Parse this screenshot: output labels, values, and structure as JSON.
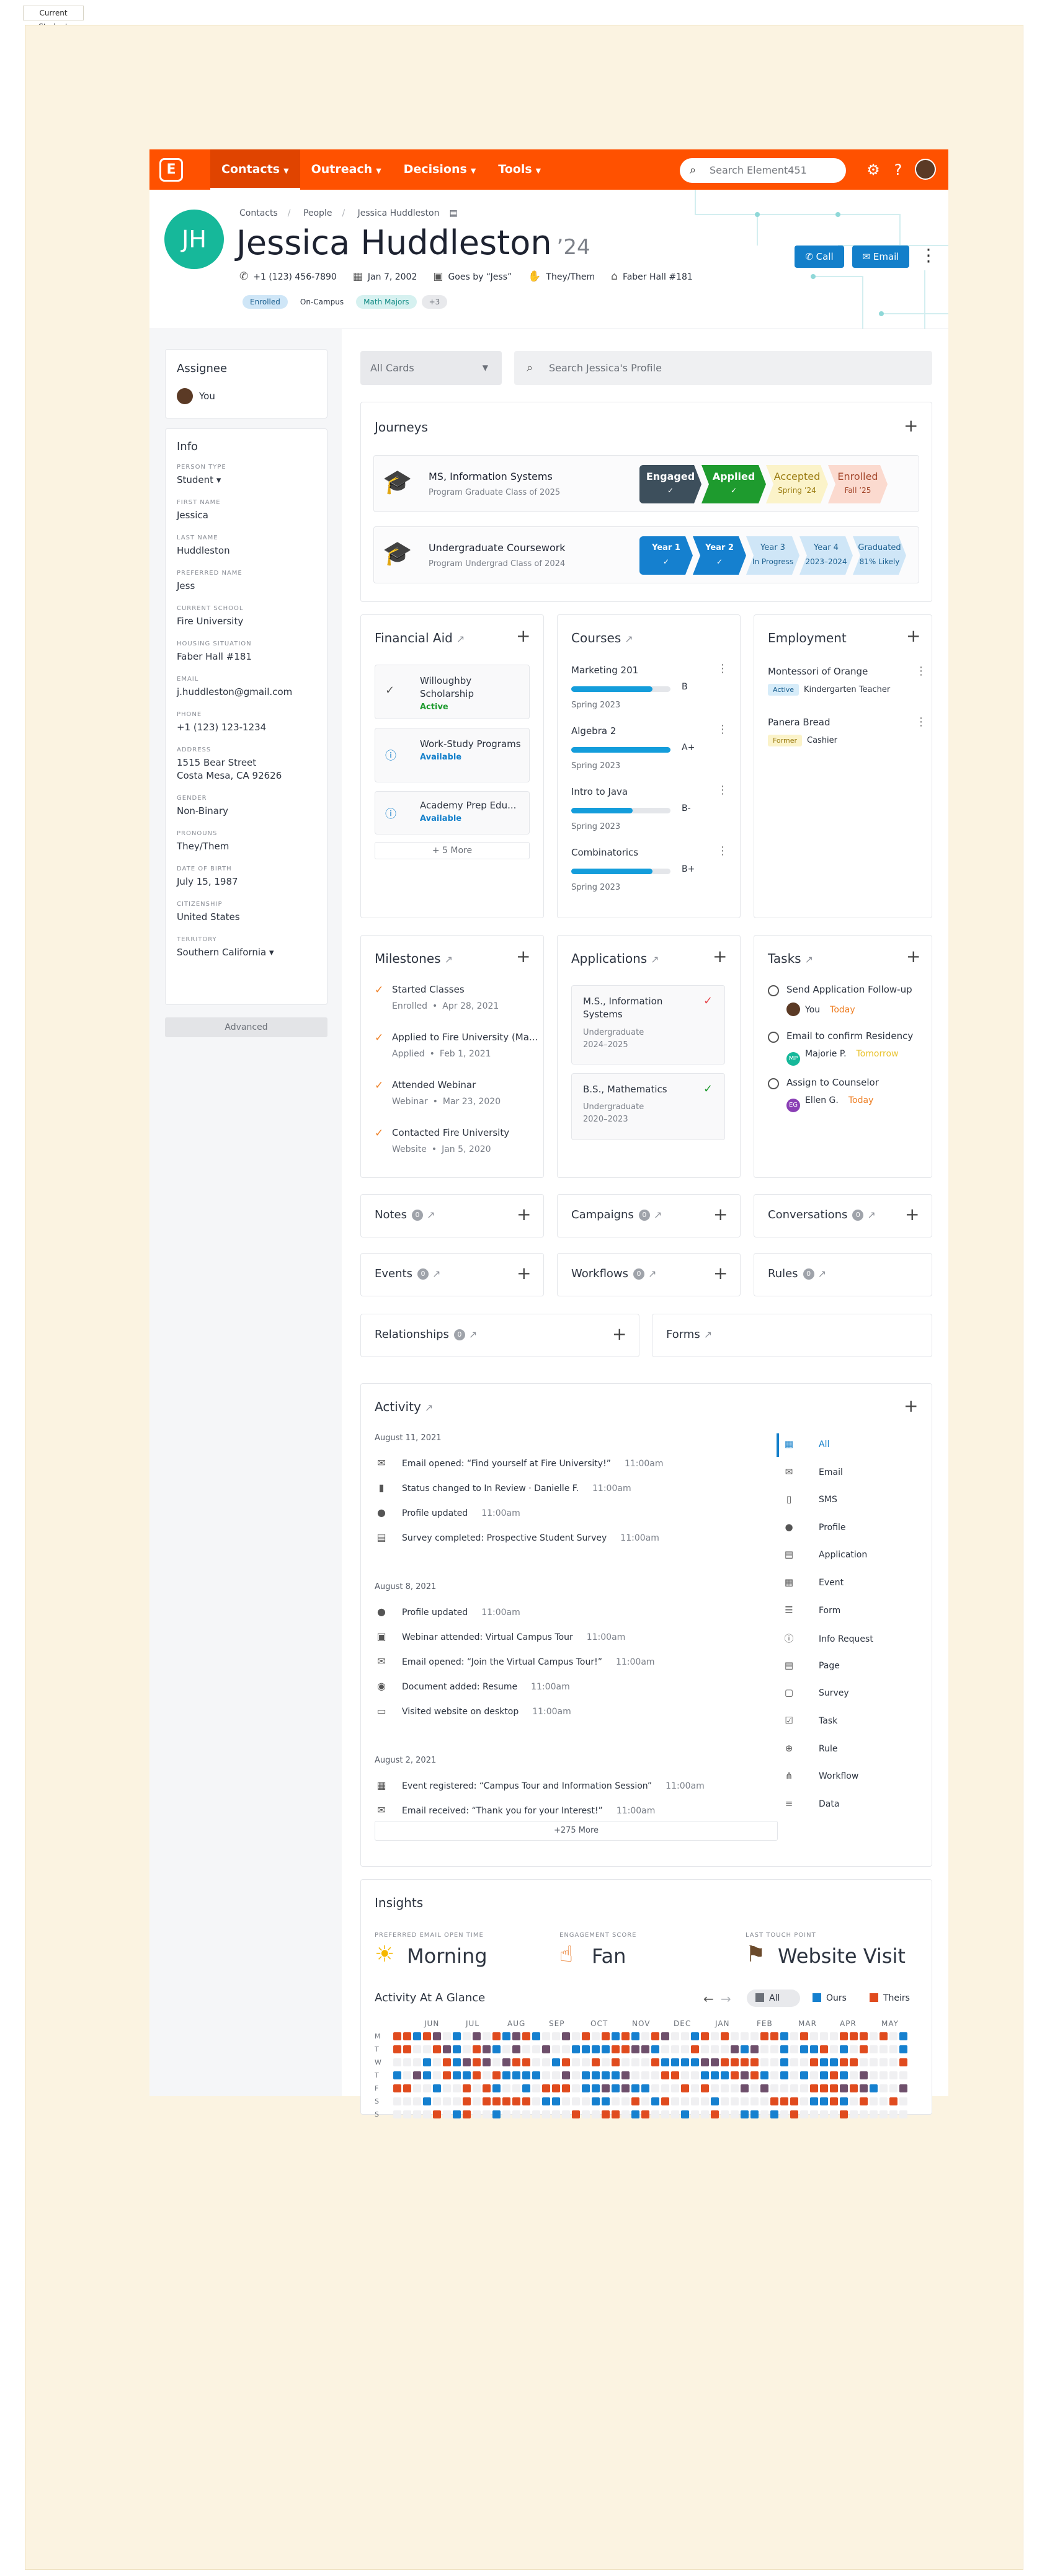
{
  "frame_label": "Current Student",
  "colors": {
    "brand": "#ff5100",
    "primary_blue": "#137fca",
    "teal_avatar": "#16b89a",
    "orange_check": "#ee7d21",
    "green_check": "#1f9d3a"
  },
  "nav": {
    "logo": "E",
    "items": [
      {
        "label": "Contacts",
        "active": true
      },
      {
        "label": "Outreach",
        "active": false
      },
      {
        "label": "Decisions",
        "active": false
      },
      {
        "label": "Tools",
        "active": false
      }
    ],
    "search_placeholder": "Search Element451",
    "icons": [
      "gear-icon",
      "help-icon"
    ]
  },
  "header": {
    "initials": "JH",
    "breadcrumbs": [
      "Contacts",
      "People",
      "Jessica Huddleston"
    ],
    "name": "Jessica Huddleston",
    "year": "’24",
    "phone": "+1 (123) 456-7890",
    "birthday": "Jan 7, 2002",
    "nickname": "Goes by “Jess”",
    "pronouns": "They/Them",
    "housing": "Faber Hall #181",
    "tags": [
      {
        "label": "Enrolled",
        "bg": "#cfe6f7",
        "fg": "#1b5f8f"
      },
      {
        "label": "On-Campus",
        "bg": "#ffffff",
        "fg": "#2d3440"
      },
      {
        "label": "Math Majors",
        "bg": "#d6f1f0",
        "fg": "#1a8f89"
      },
      {
        "label": "+3",
        "bg": "#e8e9ec",
        "fg": "#6b7078"
      }
    ],
    "call_label": "Call",
    "email_label": "Email"
  },
  "sidebar": {
    "assignee_title": "Assignee",
    "assignee": "You",
    "info_title": "Info",
    "fields": [
      {
        "label": "Person Type",
        "value": "Student ▾"
      },
      {
        "label": "First Name",
        "value": "Jessica"
      },
      {
        "label": "Last Name",
        "value": "Huddleston"
      },
      {
        "label": "Preferred Name",
        "value": "Jess"
      },
      {
        "label": "Current School",
        "value": "Fire University"
      },
      {
        "label": "Housing Situation",
        "value": "Faber Hall #181"
      },
      {
        "label": "Email",
        "value": "j.huddleston@gmail.com"
      },
      {
        "label": "Phone",
        "value": "+1 (123) 123-1234"
      },
      {
        "label": "Address",
        "value": "1515 Bear Street\nCosta Mesa, CA 92626"
      },
      {
        "label": "Gender",
        "value": "Non-Binary"
      },
      {
        "label": "Pronouns",
        "value": "They/Them"
      },
      {
        "label": "Date of Birth",
        "value": "July 15, 1987"
      },
      {
        "label": "Citizenship",
        "value": "United States"
      },
      {
        "label": "Territory",
        "value": "Southern California ▾"
      }
    ],
    "advanced_label": "Advanced"
  },
  "filters": {
    "cards_select": "All Cards",
    "profile_search_placeholder": "Search Jessica's Profile"
  },
  "journeys": {
    "title": "Journeys",
    "items": [
      {
        "title": "MS, Information Systems",
        "sub": "Program   Graduate   Class of 2025",
        "stages": [
          {
            "label": "Engaged",
            "sub": "✓",
            "bg": "#3d4f5c",
            "fg": "#ffffff"
          },
          {
            "label": "Applied",
            "sub": "✓",
            "bg": "#1e9b2e",
            "fg": "#ffffff"
          },
          {
            "label": "Accepted",
            "sub": "Spring ’24",
            "bg": "#fbf3c9",
            "fg": "#9a7b10"
          },
          {
            "label": "Enrolled",
            "sub": "Fall ’25",
            "bg": "#fbdacf",
            "fg": "#a3452a"
          }
        ]
      },
      {
        "title": "Undergraduate Coursework",
        "sub": "Program   Undergrad   Class of 2024",
        "stages": [
          {
            "label": "Year 1",
            "sub": "✓",
            "bg": "#1580cf",
            "fg": "#ffffff"
          },
          {
            "label": "Year 2",
            "sub": "✓",
            "bg": "#1580cf",
            "fg": "#ffffff"
          },
          {
            "label": "Year 3",
            "sub": "In Progress",
            "bg": "#cfe6f7",
            "fg": "#1b5f8f"
          },
          {
            "label": "Year 4",
            "sub": "2023–2024",
            "bg": "#cfe6f7",
            "fg": "#1b5f8f"
          },
          {
            "label": "Graduated",
            "sub": "81% Likely",
            "bg": "#cfe6f7",
            "fg": "#1b5f8f"
          }
        ]
      }
    ]
  },
  "financial_aid": {
    "title": "Financial Aid",
    "items": [
      {
        "name": "Willoughby Scholarship",
        "status": "Active",
        "status_color": "#1e9b2e",
        "icon": "✓"
      },
      {
        "name": "Work-Study Programs",
        "status": "Available",
        "status_color": "#137fca",
        "icon": "ⓘ"
      },
      {
        "name": "Academy Prep Edu...",
        "status": "Available",
        "status_color": "#137fca",
        "icon": "ⓘ"
      }
    ],
    "more_label": "+ 5 More"
  },
  "courses": {
    "title": "Courses",
    "items": [
      {
        "name": "Marketing 201",
        "grade": "B",
        "term": "Spring 2023",
        "progress": 0.82
      },
      {
        "name": "Algebra 2",
        "grade": "A+",
        "term": "Spring 2023",
        "progress": 1.0
      },
      {
        "name": "Intro to Java",
        "grade": "B-",
        "term": "Spring 2023",
        "progress": 0.62
      },
      {
        "name": "Combinatorics",
        "grade": "B+",
        "term": "Spring 2023",
        "progress": 0.82
      }
    ]
  },
  "employment": {
    "title": "Employment",
    "items": [
      {
        "employer": "Montessori of Orange",
        "status": "Active",
        "role": "Kindergarten Teacher",
        "status_bg": "#d6ecf9",
        "status_fg": "#1b5f8f"
      },
      {
        "employer": "Panera Bread",
        "status": "Former",
        "role": "Cashier",
        "status_bg": "#fbf3c9",
        "status_fg": "#9a7b10"
      }
    ]
  },
  "milestones": {
    "title": "Milestones",
    "items": [
      {
        "title": "Started Classes",
        "type": "Enrolled",
        "date": "Apr 28, 2021"
      },
      {
        "title": "Applied to Fire University (Ma...",
        "type": "Applied",
        "date": "Feb 1, 2021"
      },
      {
        "title": "Attended Webinar",
        "type": "Webinar",
        "date": "Mar 23, 2020"
      },
      {
        "title": "Contacted Fire University",
        "type": "Website",
        "date": "Jan 5, 2020"
      }
    ]
  },
  "applications": {
    "title": "Applications",
    "items": [
      {
        "title": "M.S., Information Systems",
        "level": "Undergraduate",
        "years": "2024–2025",
        "check_color": "#e5484d"
      },
      {
        "title": "B.S., Mathematics",
        "level": "Undergraduate",
        "years": "2020–2023",
        "check_color": "#1e9b2e"
      }
    ]
  },
  "tasks": {
    "title": "Tasks",
    "items": [
      {
        "title": "Send Application Follow-up",
        "assignee": "You",
        "due": "Today",
        "due_color": "#ee7d21",
        "avatar_bg": "#5b3a25",
        "initials": ""
      },
      {
        "title": "Email to confirm Residency",
        "assignee": "Majorie P.",
        "due": "Tomorrow",
        "due_color": "#e9c22c",
        "avatar_bg": "#16b89a",
        "initials": "MP"
      },
      {
        "title": "Assign to Counselor",
        "assignee": "Ellen G.",
        "due": "Today",
        "due_color": "#ee7d21",
        "avatar_bg": "#8a3fb5",
        "initials": "EG"
      }
    ]
  },
  "small_cards": [
    {
      "title": "Notes",
      "count": "0"
    },
    {
      "title": "Campaigns",
      "count": "0"
    },
    {
      "title": "Conversations",
      "count": "0"
    },
    {
      "title": "Events",
      "count": "0"
    },
    {
      "title": "Workflows",
      "count": "0"
    },
    {
      "title": "Rules",
      "count": "0"
    },
    {
      "title": "Relationships",
      "count": "0"
    },
    {
      "title": "Forms",
      "count": ""
    }
  ],
  "activity": {
    "title": "Activity",
    "groups": [
      {
        "date": "August 11, 2021",
        "rows": [
          {
            "icon": "✉",
            "text": "Email opened: “Find yourself at Fire University!”",
            "time": "11:00am"
          },
          {
            "icon": "▮",
            "text": "Status changed to In Review  ·  Danielle F.",
            "time": "11:00am"
          },
          {
            "icon": "●",
            "text": "Profile updated",
            "time": "11:00am"
          },
          {
            "icon": "▤",
            "text": "Survey completed: Prospective Student Survey",
            "time": "11:00am"
          }
        ]
      },
      {
        "date": "August 8, 2021",
        "rows": [
          {
            "icon": "●",
            "text": "Profile updated",
            "time": "11:00am"
          },
          {
            "icon": "▣",
            "text": "Webinar attended: Virtual Campus Tour",
            "time": "11:00am"
          },
          {
            "icon": "✉",
            "text": "Email opened: “Join the Virtual Campus Tour!”",
            "time": "11:00am"
          },
          {
            "icon": "◉",
            "text": "Document added: Resume",
            "time": "11:00am"
          },
          {
            "icon": "▭",
            "text": "Visited website on desktop",
            "time": "11:00am"
          }
        ]
      },
      {
        "date": "August 2, 2021",
        "rows": [
          {
            "icon": "▦",
            "text": "Event registered: “Campus Tour and Information Session”",
            "time": "11:00am"
          },
          {
            "icon": "✉",
            "text": "Email received: “Thank you for your Interest!”",
            "time": "11:00am"
          }
        ]
      }
    ],
    "more_label": "+275 More",
    "filters": [
      {
        "icon": "▦",
        "label": "All"
      },
      {
        "icon": "✉",
        "label": "Email"
      },
      {
        "icon": "▯",
        "label": "SMS"
      },
      {
        "icon": "●",
        "label": "Profile"
      },
      {
        "icon": "▤",
        "label": "Application"
      },
      {
        "icon": "▦",
        "label": "Event"
      },
      {
        "icon": "☰",
        "label": "Form"
      },
      {
        "icon": "ⓘ",
        "label": "Info Request"
      },
      {
        "icon": "▤",
        "label": "Page"
      },
      {
        "icon": "▢",
        "label": "Survey"
      },
      {
        "icon": "☑",
        "label": "Task"
      },
      {
        "icon": "⊕",
        "label": "Rule"
      },
      {
        "icon": "⋔",
        "label": "Workflow"
      },
      {
        "icon": "≡",
        "label": "Data"
      }
    ]
  },
  "insights": {
    "title": "Insights",
    "metrics": [
      {
        "label": "Preferred Email Open Time",
        "value": "Morning",
        "icon": "☀"
      },
      {
        "label": "Engagement Score",
        "value": "Fan",
        "icon": "☝"
      },
      {
        "label": "Last Touch Point",
        "value": "Website Visit",
        "icon": "⚑"
      }
    ],
    "glance_title": "Activity At A Glance",
    "legend": [
      "All",
      "Ours",
      "Theirs"
    ],
    "legend_colors": [
      "#6b7078",
      "#1580cf",
      "#e04b1e"
    ],
    "months": [
      "JUN",
      "JUL",
      "AUG",
      "SEP",
      "OCT",
      "NOV",
      "DEC",
      "JAN",
      "FEB",
      "MAR",
      "APR",
      "MAY"
    ],
    "days": [
      "M",
      "T",
      "W",
      "T",
      "F",
      "S",
      "S"
    ]
  }
}
